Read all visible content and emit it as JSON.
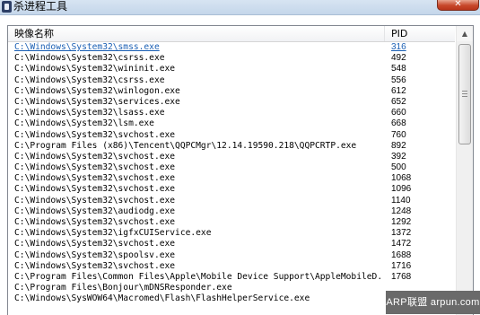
{
  "window": {
    "title": "杀进程工具",
    "close_glyph": "✕"
  },
  "list": {
    "columns": {
      "name": "映像名称",
      "pid": "PID"
    },
    "rows": [
      {
        "name": "C:\\Windows\\System32\\smss.exe",
        "pid": "316"
      },
      {
        "name": "C:\\Windows\\System32\\csrss.exe",
        "pid": "492"
      },
      {
        "name": "C:\\Windows\\System32\\wininit.exe",
        "pid": "548"
      },
      {
        "name": "C:\\Windows\\System32\\csrss.exe",
        "pid": "556"
      },
      {
        "name": "C:\\Windows\\System32\\winlogon.exe",
        "pid": "612"
      },
      {
        "name": "C:\\Windows\\System32\\services.exe",
        "pid": "652"
      },
      {
        "name": "C:\\Windows\\System32\\lsass.exe",
        "pid": "660"
      },
      {
        "name": "C:\\Windows\\System32\\lsm.exe",
        "pid": "668"
      },
      {
        "name": "C:\\Windows\\System32\\svchost.exe",
        "pid": "760"
      },
      {
        "name": "C:\\Program Files (x86)\\Tencent\\QQPCMgr\\12.14.19590.218\\QQPCRTP.exe",
        "pid": "892"
      },
      {
        "name": "C:\\Windows\\System32\\svchost.exe",
        "pid": "392"
      },
      {
        "name": "C:\\Windows\\System32\\svchost.exe",
        "pid": "500"
      },
      {
        "name": "C:\\Windows\\System32\\svchost.exe",
        "pid": "1068"
      },
      {
        "name": "C:\\Windows\\System32\\svchost.exe",
        "pid": "1096"
      },
      {
        "name": "C:\\Windows\\System32\\svchost.exe",
        "pid": "1140"
      },
      {
        "name": "C:\\Windows\\System32\\audiodg.exe",
        "pid": "1248"
      },
      {
        "name": "C:\\Windows\\System32\\svchost.exe",
        "pid": "1292"
      },
      {
        "name": "C:\\Windows\\System32\\igfxCUIService.exe",
        "pid": "1372"
      },
      {
        "name": "C:\\Windows\\System32\\svchost.exe",
        "pid": "1472"
      },
      {
        "name": "C:\\Windows\\System32\\spoolsv.exe",
        "pid": "1688"
      },
      {
        "name": "C:\\Windows\\System32\\svchost.exe",
        "pid": "1716"
      },
      {
        "name": "C:\\Program Files\\Common Files\\Apple\\Mobile Device Support\\AppleMobileD...",
        "pid": "1768"
      },
      {
        "name": "C:\\Program Files\\Bonjour\\mDNSResponder.exe",
        "pid": ""
      },
      {
        "name": "C:\\Windows\\SysWOW64\\Macromed\\Flash\\FlashHelperService.exe",
        "pid": ""
      }
    ]
  },
  "watermark": {
    "text": "ARP联盟 arpun.com"
  },
  "colors": {
    "selected_text": "#1a5fb4",
    "close_button": "#c7472a"
  }
}
